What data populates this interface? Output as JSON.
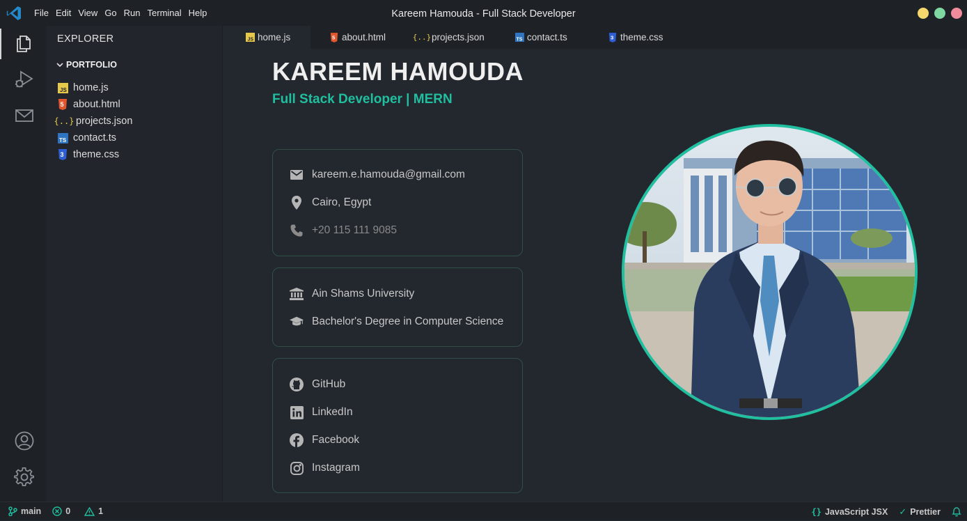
{
  "titlebar": {
    "menu": [
      "File",
      "Edit",
      "View",
      "Go",
      "Run",
      "Terminal",
      "Help"
    ],
    "title": "Kareem Hamouda - Full Stack Developer",
    "traffic_colors": [
      "#f5d76e",
      "#7fd8a0",
      "#f28b9b"
    ]
  },
  "activity": {
    "icons": [
      "files-icon",
      "run-debug-icon",
      "mail-icon",
      "account-icon",
      "settings-gear-icon"
    ]
  },
  "sidebar": {
    "title": "EXPLORER",
    "folder": "PORTFOLIO",
    "files": [
      {
        "name": "home.js",
        "icon": "js-icon"
      },
      {
        "name": "about.html",
        "icon": "html-icon"
      },
      {
        "name": "projects.json",
        "icon": "json-icon"
      },
      {
        "name": "contact.ts",
        "icon": "ts-icon"
      },
      {
        "name": "theme.css",
        "icon": "css-icon"
      }
    ]
  },
  "tabs": [
    {
      "label": "home.js",
      "active": true
    },
    {
      "label": "about.html",
      "active": false
    },
    {
      "label": "projects.json",
      "active": false
    },
    {
      "label": "contact.ts",
      "active": false
    },
    {
      "label": "theme.css",
      "active": false
    }
  ],
  "profile": {
    "name": "KAREEM HAMOUDA",
    "role": "Full Stack Developer | MERN",
    "contact": {
      "email": "kareem.e.hamouda@gmail.com",
      "location": "Cairo, Egypt",
      "phone": "+20 115 111 9085"
    },
    "education": {
      "university": "Ain Shams University",
      "degree": "Bachelor's Degree in Computer Science"
    },
    "social": {
      "github": "GitHub",
      "linkedin": "LinkedIn",
      "facebook": "Facebook",
      "instagram": "Instagram"
    },
    "accent_color": "#1fbf9f"
  },
  "statusbar": {
    "branch": "main",
    "errors": "0",
    "warnings": "1",
    "language": "JavaScript JSX",
    "formatter": "Prettier"
  }
}
